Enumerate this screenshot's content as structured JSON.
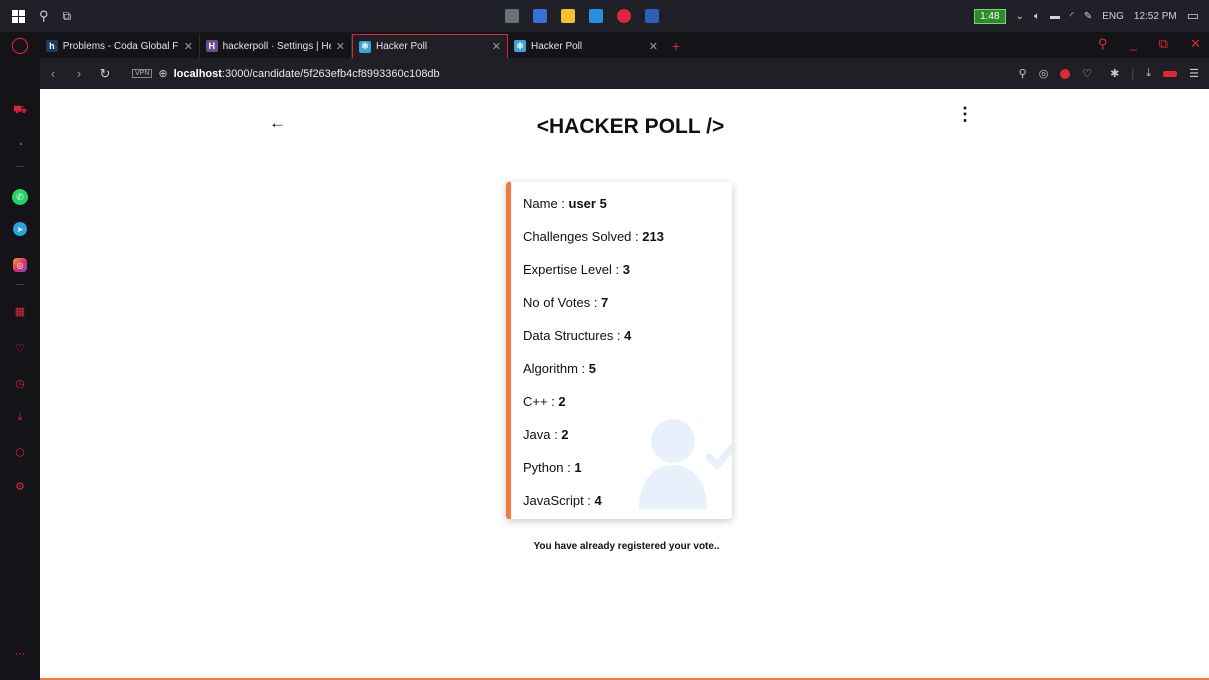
{
  "taskbar": {
    "battery": "1:48",
    "language": "ENG",
    "time": "12:52 PM"
  },
  "tabs": [
    {
      "favicon": "h",
      "favicon_color": "#1e3a5f",
      "title": "Problems - Coda Global Fu"
    },
    {
      "favicon": "H",
      "favicon_color": "#6a4c93",
      "title": "hackerpoll · Settings | Herol"
    },
    {
      "favicon": "",
      "favicon_color": "#3ea6d6",
      "title": "Hacker Poll"
    },
    {
      "favicon": "",
      "favicon_color": "#3ea6d6",
      "title": "Hacker Poll"
    }
  ],
  "address": {
    "vpn": "VPN",
    "host": "localhost",
    "path": ":3000/candidate/5f263efb4cf8993360c108db"
  },
  "page": {
    "title": "<HACKER POLL />",
    "notice": "You have already registered your vote.."
  },
  "candidate": {
    "fields": [
      {
        "label": "Name : ",
        "value": "user 5"
      },
      {
        "label": "Challenges Solved : ",
        "value": "213"
      },
      {
        "label": "Expertise Level : ",
        "value": "3"
      },
      {
        "label": "No of Votes : ",
        "value": "7"
      },
      {
        "label": "Data Structures : ",
        "value": "4"
      },
      {
        "label": "Algorithm : ",
        "value": "5"
      },
      {
        "label": "C++ : ",
        "value": "2"
      },
      {
        "label": "Java : ",
        "value": "2"
      },
      {
        "label": "Python : ",
        "value": "1"
      },
      {
        "label": "JavaScript : ",
        "value": "4"
      }
    ]
  },
  "colors": {
    "accent": "#f07b3f",
    "browser_accent": "#e2263a"
  },
  "icons": {
    "back": "back-arrow-icon",
    "menu": "more-vertical-icon",
    "avatar": "user-check-icon"
  }
}
